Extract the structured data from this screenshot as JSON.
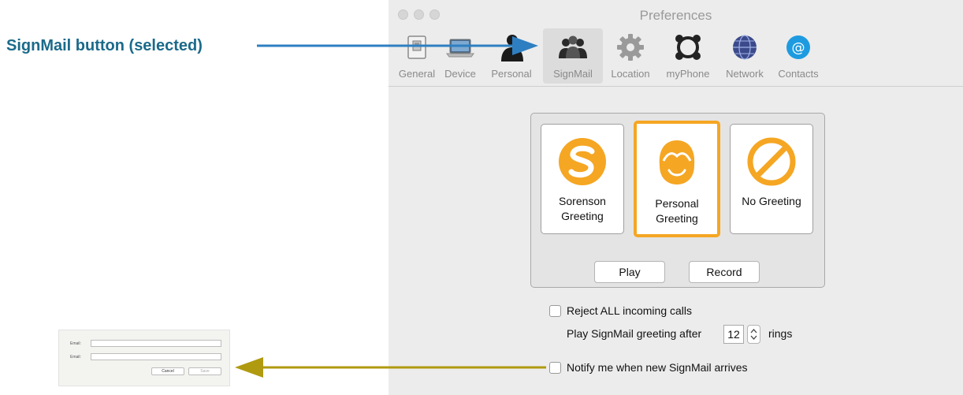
{
  "callout": {
    "text": "SignMail button (selected)",
    "color": "#1b6a8a"
  },
  "window": {
    "title": "Preferences"
  },
  "toolbar": {
    "items": [
      {
        "label": "General",
        "icon": "switch-icon"
      },
      {
        "label": "Device",
        "icon": "laptop-icon"
      },
      {
        "label": "Personal",
        "icon": "person-icon"
      },
      {
        "label": "SignMail",
        "icon": "people-icon",
        "selected": true
      },
      {
        "label": "Location",
        "icon": "gear-icon"
      },
      {
        "label": "myPhone",
        "icon": "phone-ring-icon"
      },
      {
        "label": "Network",
        "icon": "globe-icon"
      },
      {
        "label": "Contacts",
        "icon": "at-icon"
      }
    ]
  },
  "greetings": {
    "tiles": [
      {
        "line1": "Sorenson",
        "line2": "Greeting",
        "icon": "sorenson-s-icon"
      },
      {
        "line1": "Personal",
        "line2": "Greeting",
        "icon": "face-icon",
        "selected": true
      },
      {
        "line1": "No Greeting",
        "line2": "",
        "icon": "no-sign-icon"
      }
    ],
    "play_label": "Play",
    "record_label": "Record",
    "accent": "#f5a623"
  },
  "options": {
    "reject_label": "Reject ALL incoming calls",
    "reject_checked": false,
    "play_after_label": "Play SignMail greeting after",
    "rings_value": "12",
    "rings_label": "rings",
    "notify_label": "Notify me when new SignMail arrives",
    "notify_checked": false
  },
  "thumbnail": {
    "email_label_1": "Email:",
    "email_label_2": "Email:",
    "cancel_label": "Cancel",
    "save_label": "Save"
  },
  "arrows": {
    "blue": "#2e7fc1",
    "gold": "#b09a10"
  }
}
